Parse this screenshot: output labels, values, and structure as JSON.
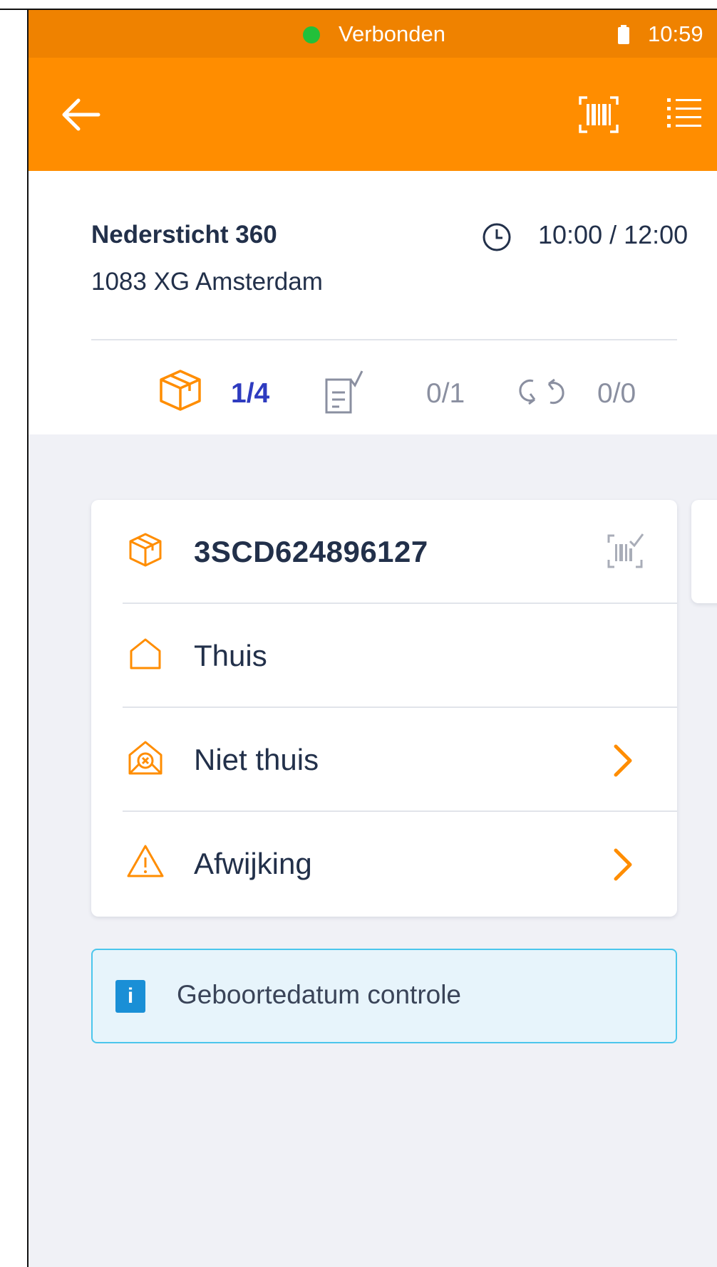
{
  "statusbar": {
    "connection_label": "Verbonden",
    "connection_color": "#22c03a",
    "battery_icon": "battery-icon",
    "time": "10:59"
  },
  "toolbar": {
    "background_color": "#ff8d00",
    "back_icon": "arrow-left-icon",
    "scan_icon": "barcode-scan-icon",
    "list_icon": "list-icon"
  },
  "stop": {
    "street": "Nedersticht 360",
    "city": "1083 XG Amsterdam",
    "time_window": "10:00 / 12:00",
    "counters": {
      "parcels": "1/4",
      "tasks": "0/1",
      "returns": "0/0"
    }
  },
  "shipment": {
    "barcode": "3SCD624896127",
    "options": [
      {
        "label": "Thuis",
        "icon": "home-icon",
        "has_chevron": false
      },
      {
        "label": "Niet thuis",
        "icon": "home-x-icon",
        "has_chevron": true
      },
      {
        "label": "Afwijking",
        "icon": "warning-icon",
        "has_chevron": true
      }
    ]
  },
  "info": {
    "icon_label": "i",
    "message": "Geboortedatum controle"
  },
  "colors": {
    "accent": "#ff8d00",
    "status_bar": "#ef8200",
    "text_primary": "#22304a",
    "counter_active": "#2e3bbf",
    "info_border": "#4bc6ec"
  }
}
